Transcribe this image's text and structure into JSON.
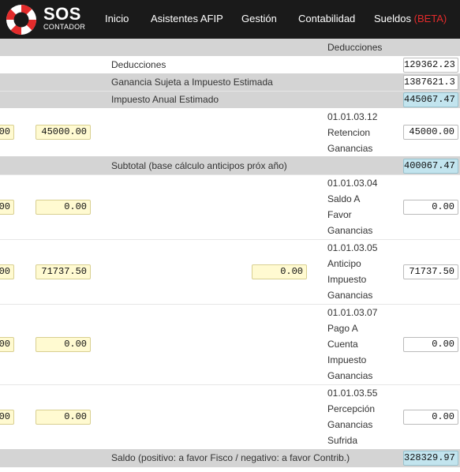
{
  "nav": {
    "brand": "SOS",
    "brand_sub": "CONTADOR",
    "items": [
      "Inicio",
      "Asistentes AFIP",
      "Gestión",
      "Contabilidad",
      "Sueldos"
    ],
    "beta": "(BETA)"
  },
  "table": {
    "header": "Deducciones",
    "deducciones": {
      "label": "Deducciones",
      "value": "129362.23"
    },
    "ganancia_sujeta": {
      "label": "Ganancia Sujeta a Impuesto Estimada",
      "value": "1387621.3"
    },
    "impuesto_anual": {
      "label": "Impuesto Anual Estimado",
      "value": "445067.47"
    },
    "retencion": {
      "col1": "00",
      "col2": "45000.00",
      "account": [
        "01.01.03.12",
        "Retencion",
        "Ganancias"
      ],
      "value": "45000.00"
    },
    "subtotal": {
      "label": "Subtotal (base cálculo anticipos próx año)",
      "value": "400067.47"
    },
    "saldo_favor": {
      "col1": "00",
      "col2": "0.00",
      "account": [
        "01.01.03.04",
        "Saldo A",
        "Favor",
        "Ganancias"
      ],
      "value": "0.00"
    },
    "anticipo": {
      "col1": "00",
      "col2": "71737.50",
      "col3": "0.00",
      "account": [
        "01.01.03.05",
        "Anticipo",
        "Impuesto",
        "Ganancias"
      ],
      "value": "71737.50"
    },
    "pago_cuenta": {
      "col1": "00",
      "col2": "0.00",
      "account": [
        "01.01.03.07",
        "Pago A",
        "Cuenta",
        "Impuesto",
        "Ganancias"
      ],
      "value": "0.00"
    },
    "percepcion": {
      "col1": "00",
      "col2": "0.00",
      "account": [
        "01.01.03.55",
        "Percepción",
        "Ganancias",
        "Sufrida"
      ],
      "value": "0.00"
    },
    "saldo": {
      "label": "Saldo (positivo: a favor Fisco / negativo: a favor Contrib.)",
      "value": "328329.97"
    }
  },
  "colors": {
    "navbar": "#1a1a1a",
    "beta": "#e32b2b",
    "gray_row": "#d4d4d4",
    "yellow_input": "#fffad1",
    "blue_total": "#c2e4ee"
  },
  "icons": {
    "logo": "lifebuoy-icon"
  }
}
